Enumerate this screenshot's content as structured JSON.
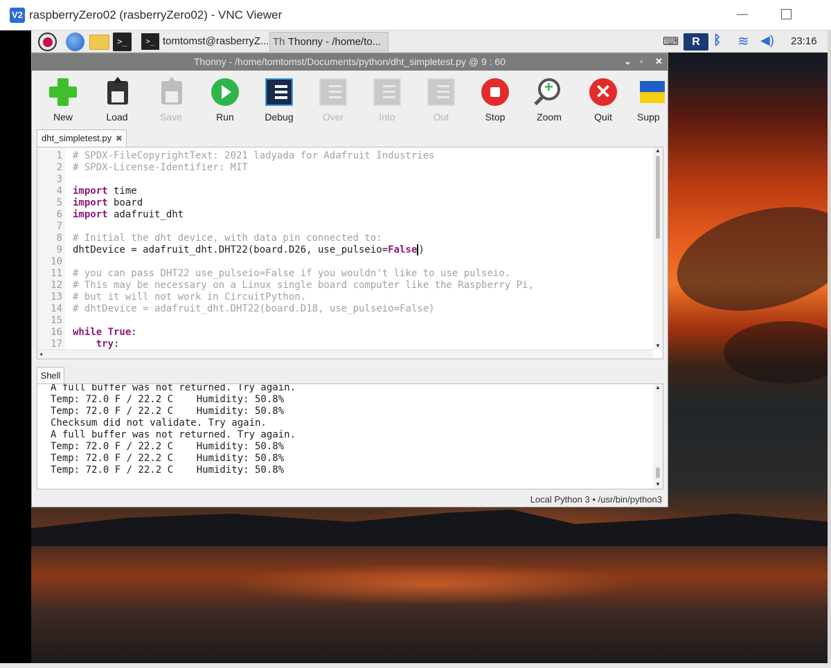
{
  "vnc": {
    "logo": "V2",
    "title": "raspberryZero02 (rasberryZero02) - VNC Viewer"
  },
  "panel": {
    "terminal_task": "tomtomst@rasberryZ...",
    "thonny_task": "Thonny  -  /home/to...",
    "clock": "23:16",
    "icons": [
      "raspberry-menu-icon",
      "web-browser-icon",
      "file-manager-icon",
      "terminal-icon",
      "keyboard-icon",
      "realvnc-icon",
      "bluetooth-icon",
      "wifi-icon",
      "volume-icon"
    ]
  },
  "thonny": {
    "title": "Thonny  -  /home/tomtomst/Documents/python/dht_simpletest.py  @  9 : 60",
    "toolbar": {
      "new": "New",
      "load": "Load",
      "save": "Save",
      "run": "Run",
      "debug": "Debug",
      "over": "Over",
      "into": "Into",
      "out": "Out",
      "stop": "Stop",
      "zoom": "Zoom",
      "quit": "Quit",
      "support": "Supp"
    },
    "editor_tab": "dht_simpletest.py",
    "editor_lines": [
      {
        "n": "1",
        "text": "# SPDX-FileCopyrightText: 2021 ladyada for Adafruit Industries"
      },
      {
        "n": "2",
        "text": "# SPDX-License-Identifier: MIT"
      },
      {
        "n": "3",
        "text": ""
      },
      {
        "n": "4",
        "kw": "import",
        "text": " time"
      },
      {
        "n": "5",
        "kw": "import",
        "text": " board"
      },
      {
        "n": "6",
        "kw": "import",
        "text": " adafruit_dht"
      },
      {
        "n": "7",
        "text": ""
      },
      {
        "n": "8",
        "text": "# Initial the dht device, with data pin connected to:"
      },
      {
        "n": "9",
        "pre": "dhtDevice = adafruit_dht.DHT22(board.D26, use_pulseio=",
        "kw": "False",
        "post": ")"
      },
      {
        "n": "10",
        "text": ""
      },
      {
        "n": "11",
        "text": "# you can pass DHT22 use_pulseio=False if you wouldn't like to use pulseio."
      },
      {
        "n": "12",
        "text": "# This may be necessary on a Linux single board computer like the Raspberry Pi,"
      },
      {
        "n": "13",
        "text": "# but it will not work in CircuitPython."
      },
      {
        "n": "14",
        "text": "# dhtDevice = adafruit_dht.DHT22(board.D18, use_pulseio=False)"
      },
      {
        "n": "15",
        "text": ""
      },
      {
        "n": "16",
        "kw": "while True",
        "post": ":"
      },
      {
        "n": "17",
        "indent": "    ",
        "kw": "try",
        "post": ":"
      }
    ],
    "shell_tab": "Shell",
    "shell_lines": [
      "A full buffer was not returned. Try again.",
      "Temp: 72.0 F / 22.2 C    Humidity: 50.8%",
      "Temp: 72.0 F / 22.2 C    Humidity: 50.8%",
      "Checksum did not validate. Try again.",
      "A full buffer was not returned. Try again.",
      "Temp: 72.0 F / 22.2 C    Humidity: 50.8%",
      "Temp: 72.0 F / 22.2 C    Humidity: 50.8%",
      "Temp: 72.0 F / 22.2 C    Humidity: 50.8%"
    ],
    "status": "Local Python 3  •  /usr/bin/python3"
  }
}
